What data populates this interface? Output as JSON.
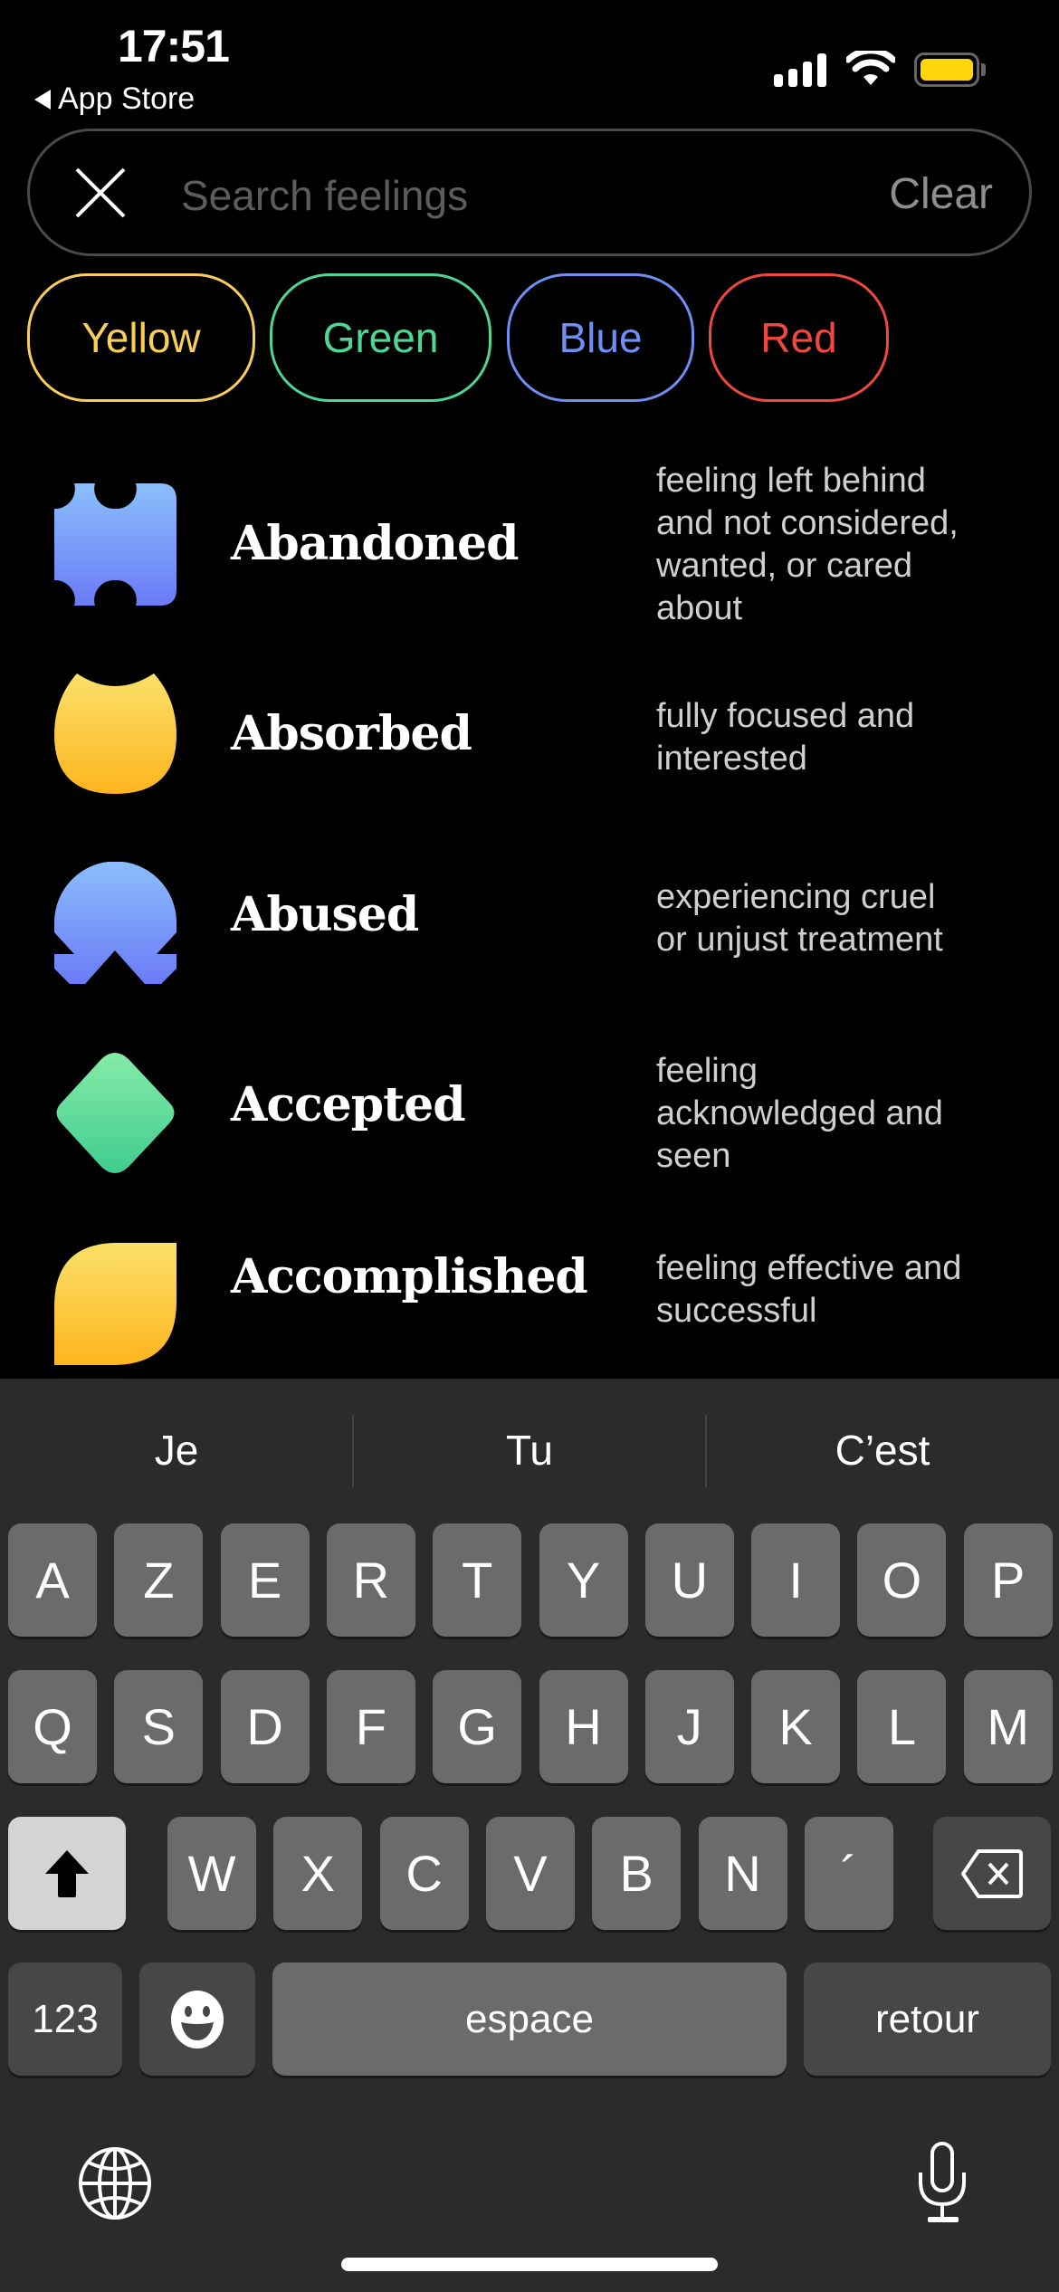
{
  "status_bar": {
    "time": "17:51",
    "back_label": "App Store",
    "signal_icon": "cellular-signal-icon",
    "wifi_icon": "wifi-icon",
    "battery_icon": "battery-icon",
    "battery_color": "#FFD60A"
  },
  "search": {
    "close_icon": "close-icon",
    "placeholder": "Search feelings",
    "value": "",
    "clear_label": "Clear"
  },
  "filters": [
    {
      "label": "Yellow",
      "color": "#F9CF57"
    },
    {
      "label": "Green",
      "color": "#4ED696"
    },
    {
      "label": "Blue",
      "color": "#6F8FF5"
    },
    {
      "label": "Red",
      "color": "#F0473F"
    }
  ],
  "feelings": [
    {
      "name": "Abandoned",
      "description": [
        "feeling left behind",
        "and not considered,",
        "wanted, or cared",
        "about"
      ],
      "color_group": "Blue",
      "shape": "notched-rectangle"
    },
    {
      "name": "Absorbed",
      "description": [
        "fully focused and",
        "interested"
      ],
      "color_group": "Yellow",
      "shape": "scooped-oval"
    },
    {
      "name": "Abused",
      "description": [
        "experiencing cruel",
        "or unjust treatment"
      ],
      "color_group": "Blue",
      "shape": "notched-dome"
    },
    {
      "name": "Accepted",
      "description": [
        "feeling",
        "acknowledged and",
        "seen"
      ],
      "color_group": "Green",
      "shape": "rounded-diamond"
    },
    {
      "name": "Accomplished",
      "description": [
        "feeling effective and",
        "successful"
      ],
      "color_group": "Yellow",
      "shape": "leaf"
    }
  ],
  "gradients": {
    "Blue": [
      "#8BBEFB",
      "#6B7BF7"
    ],
    "Yellow": [
      "#FBE06A",
      "#FDB51E"
    ],
    "Green": [
      "#86EBA9",
      "#40CC8E"
    ]
  },
  "keyboard": {
    "suggestions": [
      "Je",
      "Tu",
      "C’est"
    ],
    "row1": [
      "A",
      "Z",
      "E",
      "R",
      "T",
      "Y",
      "U",
      "I",
      "O",
      "P"
    ],
    "row2": [
      "Q",
      "S",
      "D",
      "F",
      "G",
      "H",
      "J",
      "K",
      "L",
      "M"
    ],
    "row3": [
      "W",
      "X",
      "C",
      "V",
      "B",
      "N",
      "´"
    ],
    "shift_icon": "shift-icon",
    "delete_icon": "delete-icon",
    "numbers_label": "123",
    "emoji_icon": "emoji-icon",
    "space_label": "espace",
    "return_label": "retour",
    "globe_icon": "globe-icon",
    "mic_icon": "microphone-icon"
  }
}
